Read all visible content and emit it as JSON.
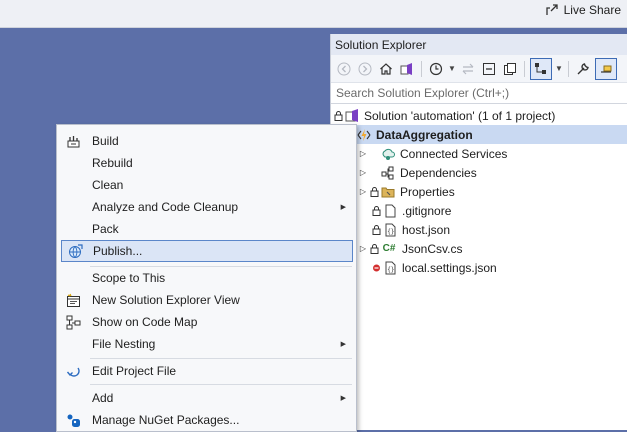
{
  "topbar": {
    "live_share": "Live Share"
  },
  "solution_explorer": {
    "title": "Solution Explorer",
    "search_placeholder": "Search Solution Explorer (Ctrl+;)",
    "tree": [
      {
        "label": "Solution 'automation' (1 of 1 project)",
        "icon": "solution-icon",
        "depth": 0
      },
      {
        "label": "DataAggregation",
        "icon": "function-app-icon",
        "depth": 0,
        "selected": true
      },
      {
        "label": "Connected Services",
        "icon": "connected-services-icon",
        "depth": 1
      },
      {
        "label": "Dependencies",
        "icon": "dependencies-icon",
        "depth": 1
      },
      {
        "label": "Properties",
        "icon": "folder-icon",
        "depth": 1
      },
      {
        "label": ".gitignore",
        "icon": "file-icon",
        "depth": 1
      },
      {
        "label": "host.json",
        "icon": "json-file-icon",
        "depth": 1
      },
      {
        "label": "JsonCsv.cs",
        "icon": "csharp-file-icon",
        "depth": 1
      },
      {
        "label": "local.settings.json",
        "icon": "json-file-icon",
        "depth": 1
      }
    ],
    "csharp_badge": "C#"
  },
  "context_menu": {
    "items": [
      {
        "label": "Build",
        "icon": "build-icon"
      },
      {
        "label": "Rebuild"
      },
      {
        "label": "Clean"
      },
      {
        "label": "Analyze and Code Cleanup",
        "submenu": true
      },
      {
        "label": "Pack"
      },
      {
        "label": "Publish...",
        "icon": "publish-globe-icon",
        "highlighted": true
      },
      {
        "label": "Scope to This"
      },
      {
        "label": "New Solution Explorer View",
        "icon": "new-view-icon"
      },
      {
        "label": "Show on Code Map",
        "icon": "code-map-icon"
      },
      {
        "label": "File Nesting",
        "submenu": true
      },
      {
        "label": "Edit Project File",
        "icon": "edit-arrow-icon"
      },
      {
        "label": "Add",
        "submenu": true
      },
      {
        "label": "Manage NuGet Packages...",
        "icon": "nuget-icon"
      }
    ]
  },
  "colors": {
    "background": "#5c6fa8",
    "accent": "#3d6bb5",
    "highlight": "#dbe5f6"
  }
}
